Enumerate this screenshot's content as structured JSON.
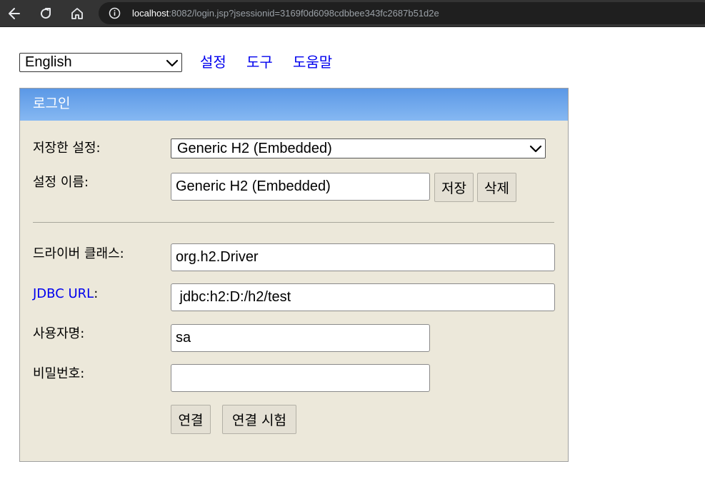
{
  "browser": {
    "url_host": "localhost",
    "url_rest": ":8082/login.jsp?jsessionid=3169f0d6098cdbbee343fc2687b51d2e",
    "icons": [
      "back-arrow-icon",
      "reload-icon",
      "home-icon",
      "info-icon"
    ]
  },
  "toolbar": {
    "language": "English",
    "links": [
      "설정",
      "도구",
      "도움말"
    ]
  },
  "login": {
    "title": "로그인",
    "saved_settings_label": "저장한 설정:",
    "saved_settings_value": "Generic H2 (Embedded)",
    "setting_name_label": "설정 이름:",
    "setting_name_value": "Generic H2 (Embedded)",
    "save_button": "저장",
    "delete_button": "삭제",
    "driver_class_label": "드라이버 클래스:",
    "driver_class_value": "org.h2.Driver",
    "jdbc_url_link": "JDBC URL",
    "jdbc_url_colon": ":",
    "jdbc_url_value": " jdbc:h2:D:/h2/test",
    "username_label": "사용자명:",
    "username_value": "sa",
    "password_label": "비밀번호:",
    "password_value": "",
    "connect_button": "연결",
    "test_connection_button": "연결 시험"
  },
  "colors": {
    "panel_background": "#ece8da",
    "header_gradient_top": "#5b98e6",
    "header_gradient_bottom": "#86b8f2",
    "link": "#0000ee",
    "browser_bar": "#343434"
  }
}
